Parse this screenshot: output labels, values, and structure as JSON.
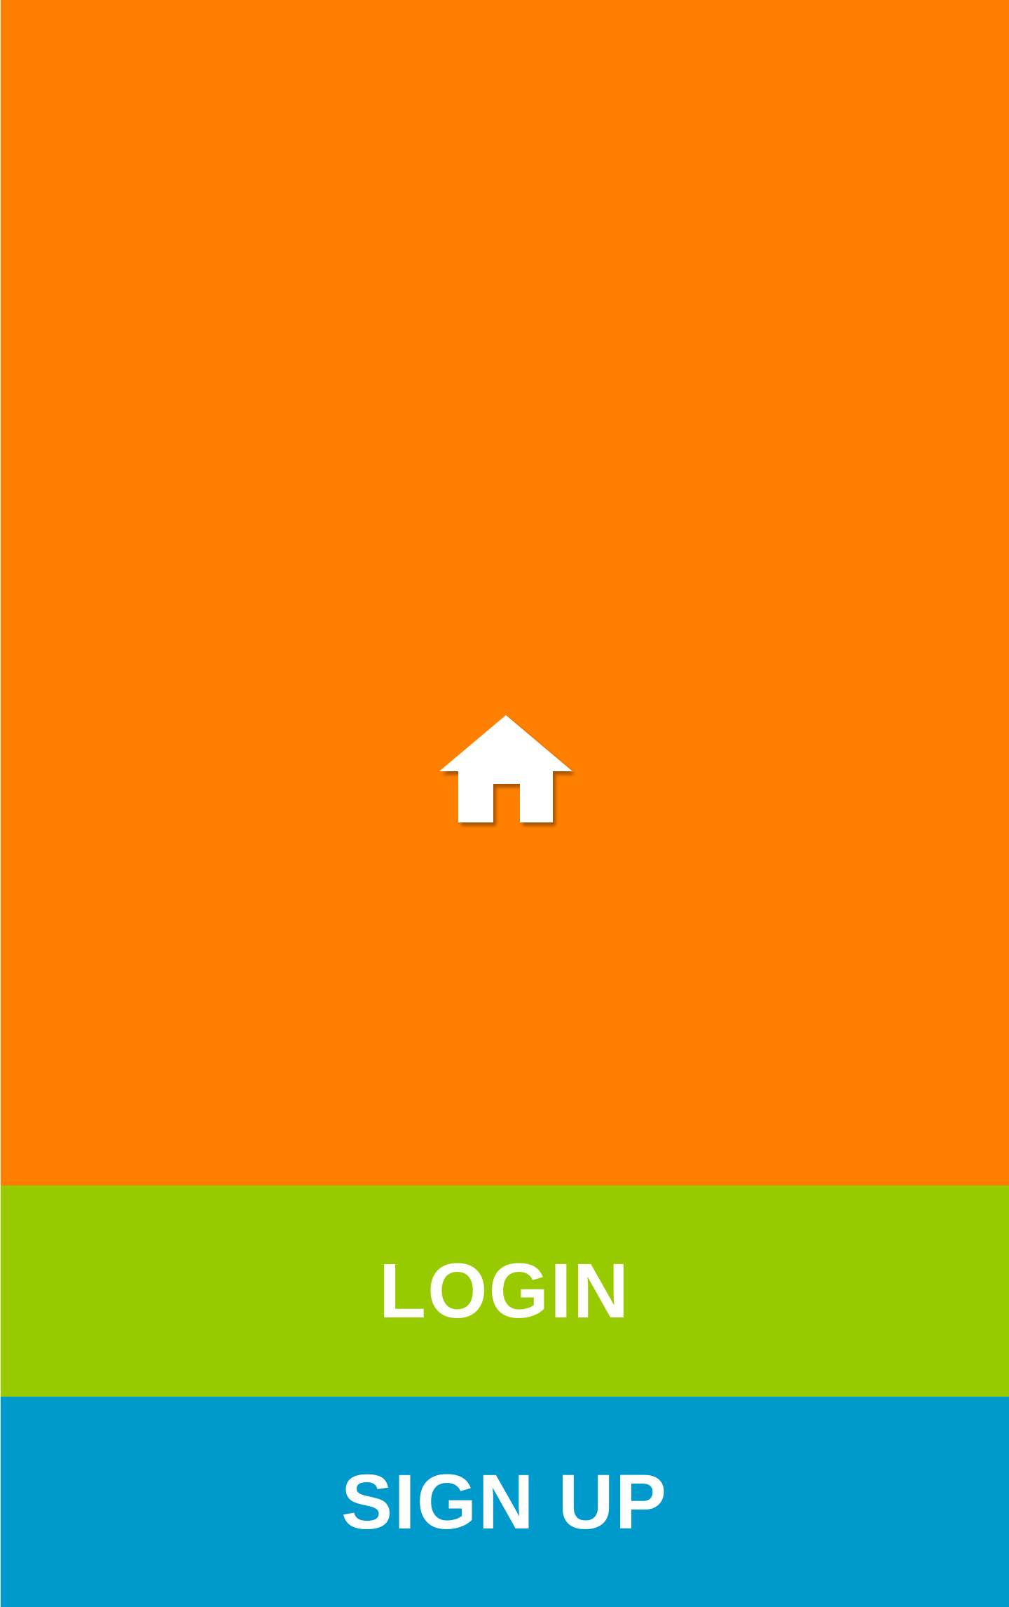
{
  "colors": {
    "hero_bg": "#ff8000",
    "login_bg": "#97cb00",
    "signup_bg": "#0099cc",
    "text": "#ffffff"
  },
  "hero": {
    "icon": "home-icon"
  },
  "actions": {
    "login_label": "LOGIN",
    "signup_label": "SIGN UP"
  }
}
